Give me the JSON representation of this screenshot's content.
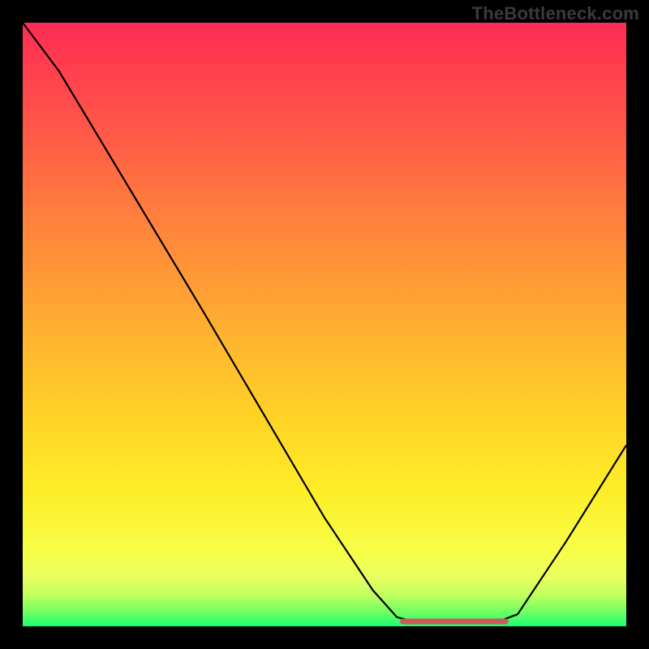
{
  "watermark": "TheBottleneck.com",
  "chart_data": {
    "type": "line",
    "title": "",
    "xlabel": "",
    "ylabel": "",
    "xlim": [
      0,
      100
    ],
    "ylim": [
      0,
      100
    ],
    "series": [
      {
        "name": "bottleneck-curve",
        "points": [
          {
            "x": 0,
            "y": 100
          },
          {
            "x": 6,
            "y": 92
          },
          {
            "x": 12,
            "y": 82
          },
          {
            "x": 30,
            "y": 52
          },
          {
            "x": 50,
            "y": 18
          },
          {
            "x": 58,
            "y": 6
          },
          {
            "x": 62,
            "y": 1.5
          },
          {
            "x": 66,
            "y": 0.5
          },
          {
            "x": 78,
            "y": 0.5
          },
          {
            "x": 82,
            "y": 2
          },
          {
            "x": 90,
            "y": 14
          },
          {
            "x": 100,
            "y": 30
          }
        ]
      },
      {
        "name": "optimal-zone-underline",
        "points": [
          {
            "x": 63,
            "y": 0.8
          },
          {
            "x": 80,
            "y": 0.8
          }
        ]
      }
    ],
    "colors": {
      "curve": "#000000",
      "underline": "#cc5a5a",
      "gradient_top": "#ff2a55",
      "gradient_bottom": "#1bff71"
    }
  }
}
